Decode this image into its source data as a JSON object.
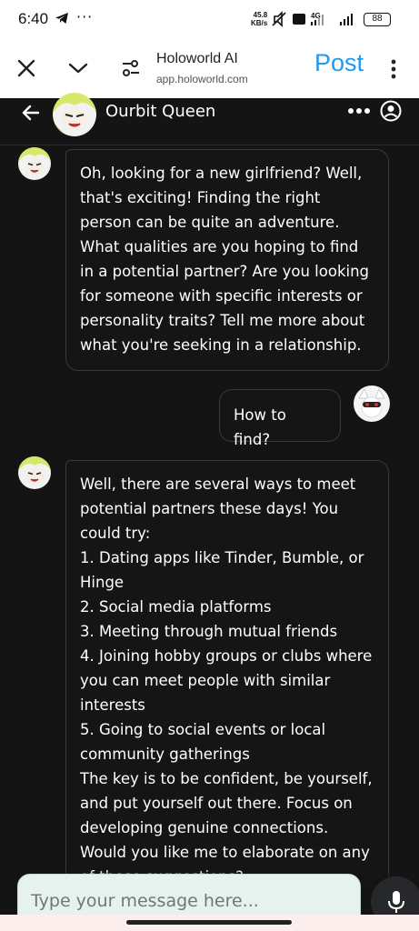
{
  "status_bar": {
    "time": "6:40",
    "speed_value": "45.8",
    "speed_unit": "KB/s",
    "network": "4G",
    "battery": "88"
  },
  "browser": {
    "title": "Holoworld AI",
    "url": "app.holoworld.com",
    "post_label": "Post"
  },
  "chat": {
    "name": "Ourbit Queen",
    "messages": [
      {
        "sender": "bot",
        "text": "Oh, looking for a new girlfriend? Well, that's exciting! Finding the right person can be quite an adventure. What qualities are you hoping to find in a potential partner? Are you looking for someone with specific interests or personality traits? Tell me more about what you're seeking in a relationship."
      },
      {
        "sender": "user",
        "text": "How to find?"
      },
      {
        "sender": "bot",
        "text": "Well, there are several ways to meet potential partners these days! You could try:\n1. Dating apps like Tinder, Bumble, or Hinge\n2. Social media platforms\n3. Meeting through mutual friends\n4. Joining hobby groups or clubs where you can meet people with similar interests\n5. Going to social events or local community gatherings\nThe key is to be confident, be yourself, and put yourself out there. Focus on developing genuine connections. Would you like me to elaborate on any of these suggestions?"
      }
    ]
  },
  "composer": {
    "placeholder": "Type your message here..."
  },
  "colors": {
    "accent": "#1d9bf0",
    "background": "#141414",
    "composer_bg": "#e6f2ee"
  }
}
